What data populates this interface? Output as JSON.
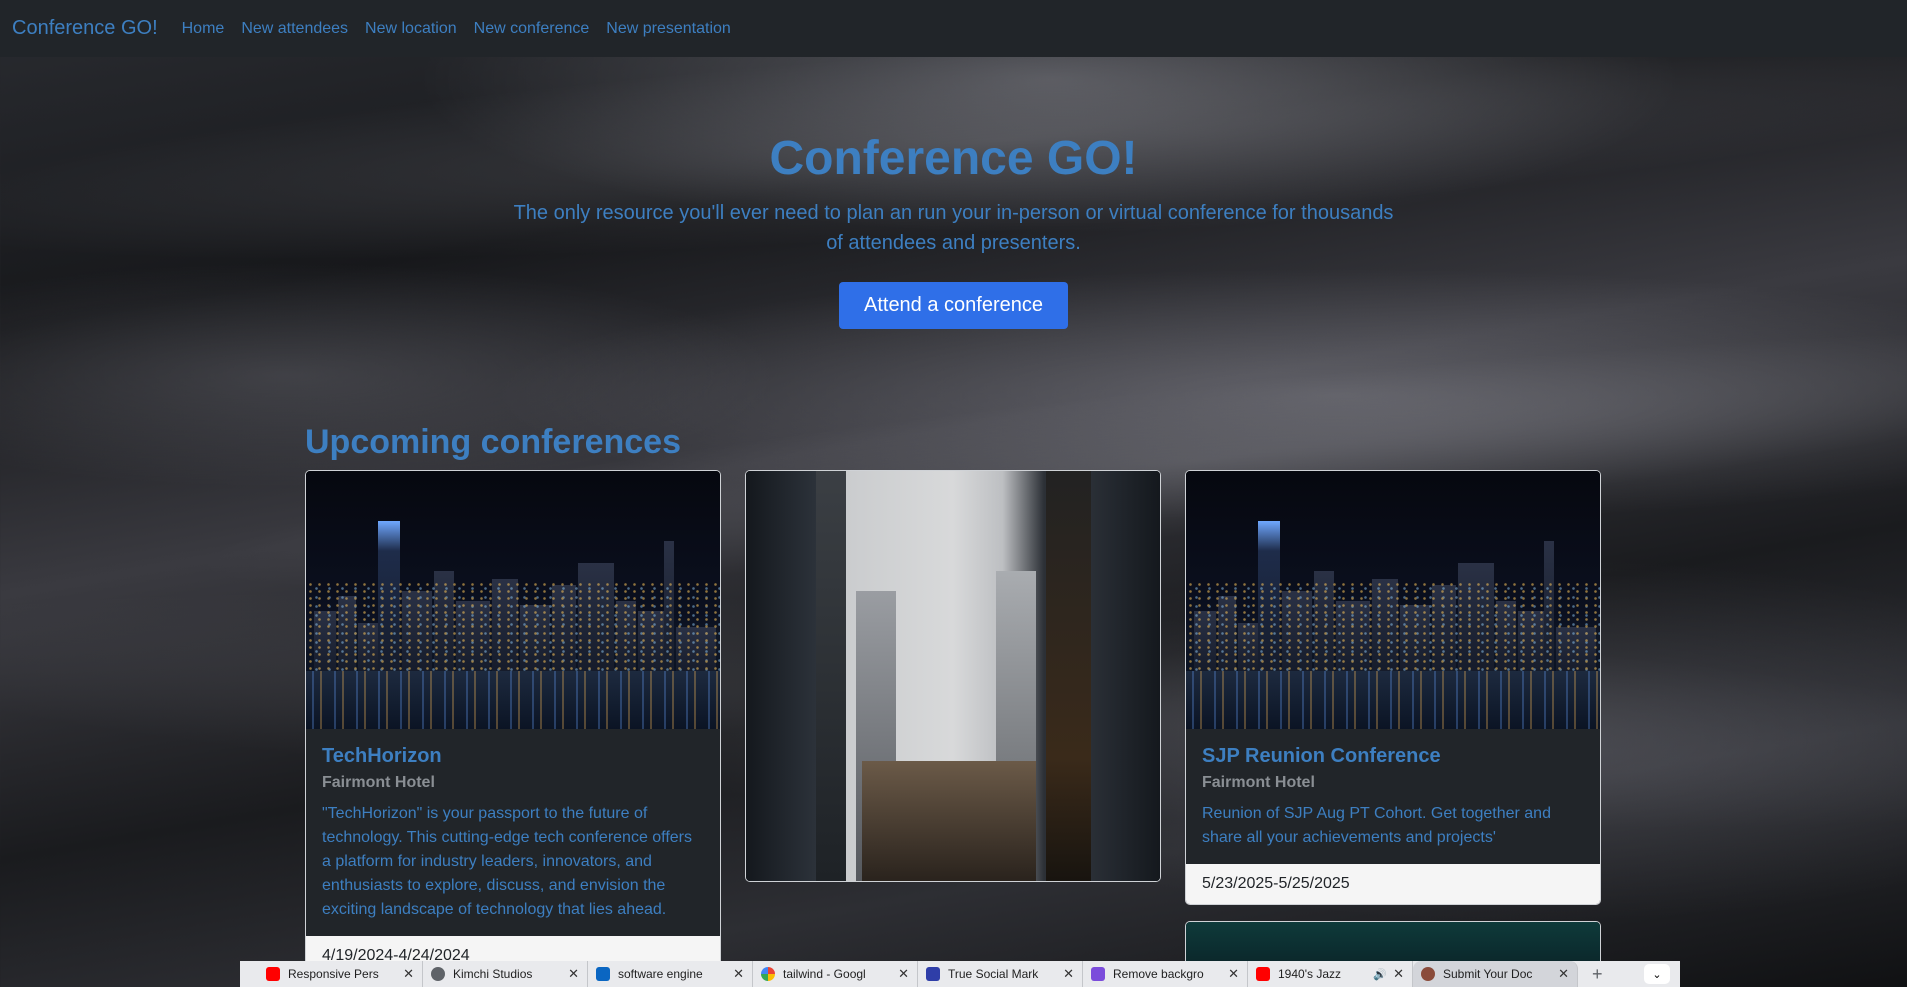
{
  "navbar": {
    "brand": "Conference GO!",
    "links": [
      "Home",
      "New attendees",
      "New location",
      "New conference",
      "New presentation"
    ]
  },
  "hero": {
    "title": "Conference GO!",
    "lead": "The only resource you'll ever need to plan an run your in-person or virtual conference for thousands of attendees and presenters.",
    "button": "Attend a conference"
  },
  "section_title": "Upcoming conferences",
  "cards": [
    {
      "title": "TechHorizon",
      "location": "Fairmont Hotel",
      "description": "\"TechHorizon\" is your passport to the future of technology. This cutting-edge tech conference offers a platform for industry leaders, innovators, and enthusiasts to explore, discuss, and envision the exciting landscape of technology that lies ahead.",
      "dates": "4/19/2024-4/24/2024",
      "image": "city-skyline-night"
    },
    {
      "image": "city-street-towers"
    },
    {
      "title": "SJP Reunion Conference",
      "location": "Fairmont Hotel",
      "description": "Reunion of SJP Aug PT Cohort. Get together and share all your achievements and projects'",
      "dates": "5/23/2025-5/25/2025",
      "image": "city-skyline-night"
    }
  ],
  "browser_tabs": [
    {
      "label": "Responsive Pers",
      "icon": "youtube-icon",
      "color": "#ff0000"
    },
    {
      "label": "Kimchi Studios",
      "icon": "globe-icon",
      "color": "#5f6368"
    },
    {
      "label": "software engine",
      "icon": "linkedin-icon",
      "color": "#0a66c2"
    },
    {
      "label": "tailwind - Googl",
      "icon": "google-icon",
      "color": "#4285f4"
    },
    {
      "label": "True Social Mark",
      "icon": "truesocial-icon",
      "color": "#2f3ea8"
    },
    {
      "label": "Remove backgro",
      "icon": "removebg-icon",
      "color": "#7b4cdb"
    },
    {
      "label": "1940's Jazz",
      "icon": "youtube-icon",
      "color": "#ff0000",
      "audio": true
    },
    {
      "label": "Submit Your Doc",
      "icon": "doc-icon",
      "color": "#8a4b3a",
      "active": true
    }
  ]
}
